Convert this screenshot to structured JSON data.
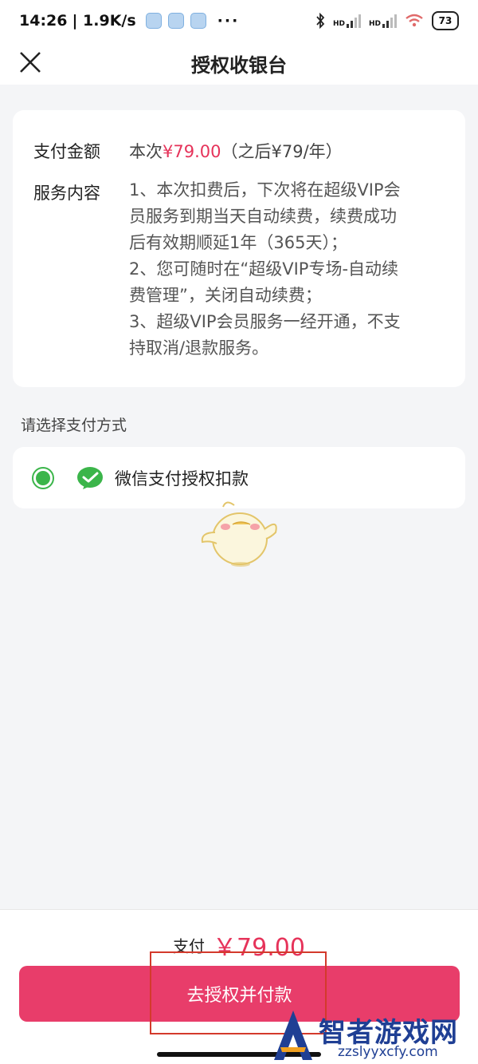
{
  "status_bar": {
    "time": "14:26",
    "net_speed": "| 1.9K/s",
    "dots": "···",
    "hd1": "HD",
    "hd2": "HD",
    "battery": "73"
  },
  "nav": {
    "title": "授权收银台",
    "close_icon": "close-icon"
  },
  "info": {
    "amount_label": "支付金额",
    "amount_prefix": "本次",
    "amount_price": "¥79.00",
    "amount_suffix": "（之后¥79/年）",
    "service_label": "服务内容",
    "service_lines": [
      "1、本次扣费后，下次将在超级VIP会",
      "员服务到期当天自动续费，续费成功",
      "后有效期顺延1年（365天）；",
      "2、您可随时在“超级VIP专场-自动续",
      "费管理”，关闭自动续费；",
      "3、超级VIP会员服务一经开通，不支",
      "持取消/退款服务。"
    ]
  },
  "payment": {
    "section_title": "请选择支付方式",
    "method_label": "微信支付授权扣款",
    "method_selected": true,
    "method_icon": "wechat-pay-icon",
    "accent_color": "#3bb54a"
  },
  "footer": {
    "total_label": "支付",
    "total_amount": "￥79.00",
    "button_label": "去授权并付款",
    "button_color": "#e83d6a",
    "price_color": "#e6335a"
  },
  "watermark": {
    "name": "智者游戏网",
    "url": "zzslyyxcfy.com"
  }
}
